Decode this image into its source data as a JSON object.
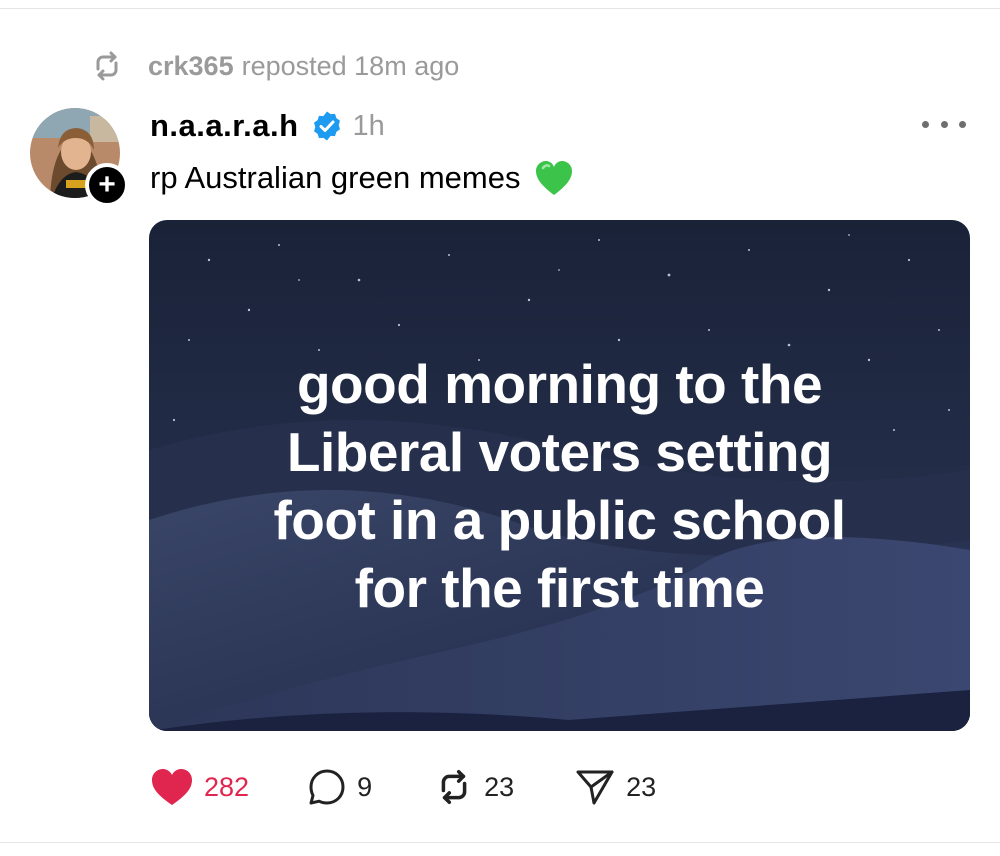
{
  "repost": {
    "user": "crk365",
    "text": "reposted 18m ago",
    "icon": "repost-icon"
  },
  "post": {
    "username": "n.a.a.r.a.h",
    "verified": true,
    "time": "1h",
    "caption": "rp Australian green memes",
    "caption_emoji": "green-heart-emoji",
    "follow_badge": "+",
    "image_text": [
      "good morning to the",
      "Liberal voters setting",
      "foot in a public school",
      "for the first time"
    ]
  },
  "actions": {
    "likes": "282",
    "replies": "9",
    "reposts": "23",
    "shares": "23"
  },
  "colors": {
    "like_accent": "#e0264f",
    "verified_blue": "#1d9bf0",
    "muted_text": "#9a9a9a",
    "emoji_green": "#3cc44a"
  }
}
